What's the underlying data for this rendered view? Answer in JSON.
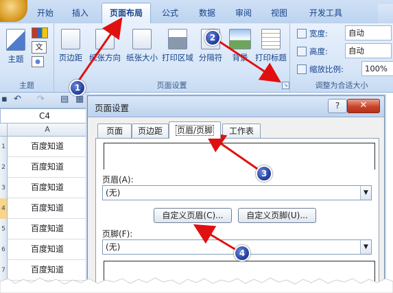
{
  "ribbon": {
    "tabs": [
      {
        "label": "开始"
      },
      {
        "label": "插入"
      },
      {
        "label": "页面布局"
      },
      {
        "label": "公式"
      },
      {
        "label": "数据"
      },
      {
        "label": "审阅"
      },
      {
        "label": "视图"
      },
      {
        "label": "开发工具"
      }
    ],
    "theme_group": {
      "label": "主题",
      "button": "主题",
      "mini_icon_1": "文",
      "mini_icon_2": "文"
    },
    "page_setup_group": {
      "label": "页面设置",
      "buttons": [
        "页边距",
        "纸张方向",
        "纸张大小",
        "打印区域",
        "分隔符",
        "背景",
        "打印标题"
      ]
    },
    "scale_group": {
      "label": "调整为合适大小",
      "width_label": "宽度:",
      "width_value": "自动",
      "height_label": "高度:",
      "height_value": "自动",
      "scale_label": "缩放比例:",
      "scale_value": "100%"
    }
  },
  "sheet": {
    "name_box": "C4",
    "column_header": "A",
    "rows": [
      {
        "num": "1",
        "value": "百度知道"
      },
      {
        "num": "2",
        "value": "百度知道"
      },
      {
        "num": "3",
        "value": "百度知道"
      },
      {
        "num": "4",
        "value": "百度知道"
      },
      {
        "num": "5",
        "value": "百度知道"
      },
      {
        "num": "6",
        "value": "百度知道"
      },
      {
        "num": "7",
        "value": "百度知道"
      }
    ]
  },
  "dialog": {
    "title": "页面设置",
    "help": "?",
    "close": "✕",
    "tabs": [
      "页面",
      "页边距",
      "页眉/页脚",
      "工作表"
    ],
    "header_label": "页眉(A):",
    "header_value": "(无)",
    "custom_header_button": "自定义页眉(C)...",
    "custom_footer_button": "自定义页脚(U)...",
    "footer_label": "页脚(F):",
    "footer_value": "(无)"
  },
  "annotations": [
    "1",
    "2",
    "3",
    "4"
  ],
  "colors": {
    "arrow": "#e01010",
    "badge": "#1e3a9a",
    "ribbon": "#d6e5f7",
    "close": "#c9442a"
  }
}
